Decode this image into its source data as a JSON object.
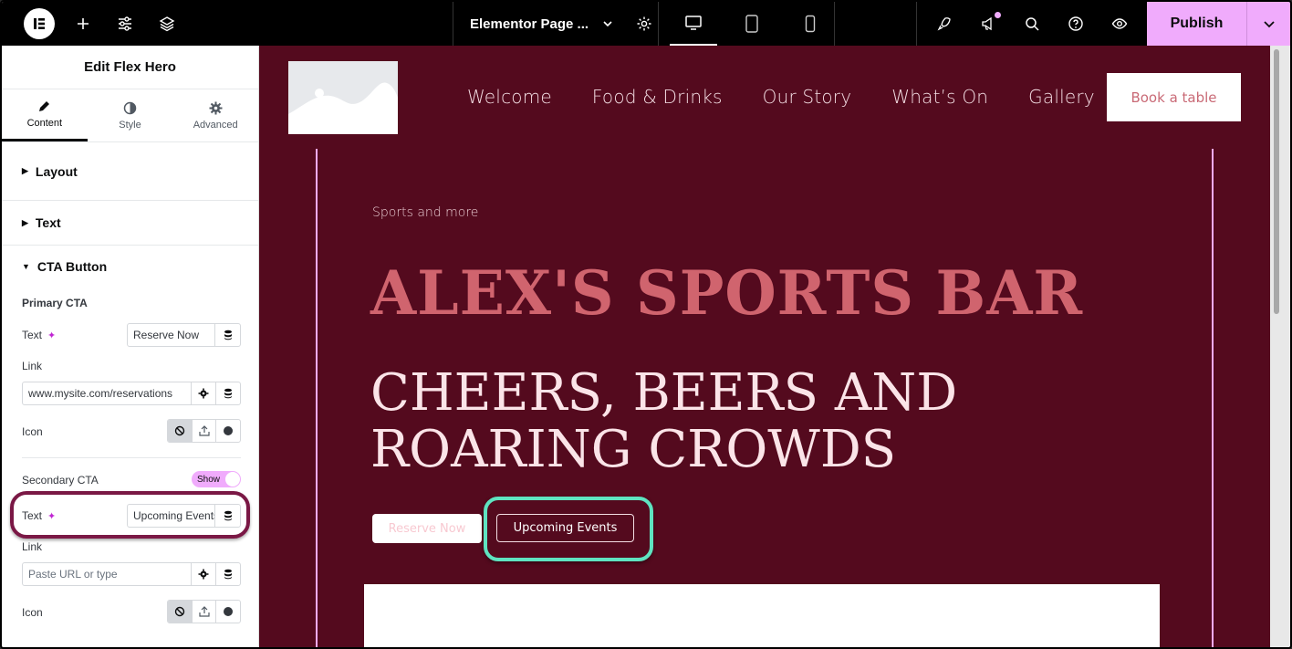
{
  "topbar": {
    "doc_title": "Elementor Page ...",
    "publish_label": "Publish",
    "accent": "#f0abfc",
    "icons": [
      "elementor-logo-icon",
      "add-icon",
      "settings-sliders-icon",
      "layers-icon",
      "chevron-down-icon",
      "gear-icon",
      "desktop-icon",
      "tablet-icon",
      "mobile-icon",
      "rocket-icon",
      "megaphone-icon",
      "search-icon",
      "help-icon",
      "eye-icon"
    ]
  },
  "panel": {
    "title": "Edit Flex Hero",
    "tabs": [
      {
        "label": "Content",
        "icon": "pencil-icon"
      },
      {
        "label": "Style",
        "icon": "half-circle-icon"
      },
      {
        "label": "Advanced",
        "icon": "gear-icon"
      }
    ],
    "sections": {
      "layout": "Layout",
      "text": "Text",
      "cta": "CTA Button"
    },
    "primary": {
      "heading": "Primary CTA",
      "text_label": "Text",
      "text_value": "Reserve Now",
      "link_label": "Link",
      "link_value": "www.mysite.com/reservations",
      "icon_label": "Icon"
    },
    "secondary": {
      "heading": "Secondary CTA",
      "toggle_label": "Show",
      "text_label": "Text",
      "text_value": "Upcoming Events",
      "link_label": "Link",
      "link_placeholder": "Paste URL or type",
      "icon_label": "Icon"
    }
  },
  "site": {
    "nav": [
      "Welcome",
      "Food & Drinks",
      "Our Story",
      "What’s On",
      "Gallery"
    ],
    "book_button": "Book a table",
    "eyebrow": "Sports and more",
    "title": "ALEX'S SPORTS BAR",
    "subtitle": "CHEERS, BEERS AND ROARING CROWDS",
    "primary_cta": "Reserve Now",
    "secondary_cta": "Upcoming Events",
    "bg_color": "#540a1e",
    "title_color": "#d0646e"
  }
}
